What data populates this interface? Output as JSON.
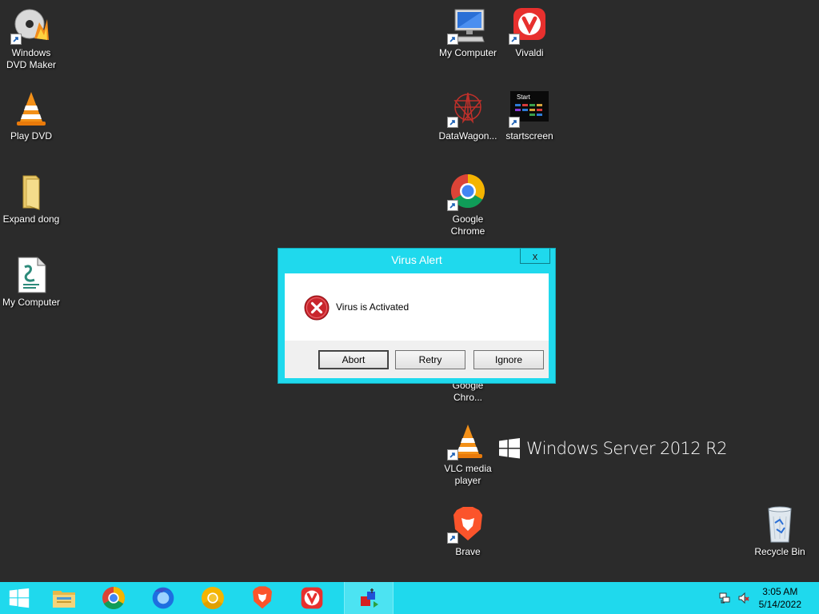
{
  "desktop": {
    "icons": [
      {
        "label": "Windows DVD Maker",
        "icon": "dvd-maker-icon"
      },
      {
        "label": "Play DVD",
        "icon": "vlc-cone-icon"
      },
      {
        "label": "Expand dong",
        "icon": "folder-icon"
      },
      {
        "label": "My Computer",
        "icon": "script-file-icon"
      },
      {
        "label": "My Computer",
        "icon": "computer-icon"
      },
      {
        "label": "Vivaldi",
        "icon": "vivaldi-icon"
      },
      {
        "label": "DataWagon...",
        "icon": "datawagon-icon"
      },
      {
        "label": "startscreen",
        "icon": "startscreen-icon"
      },
      {
        "label": "Google Chrome",
        "icon": "chrome-icon"
      },
      {
        "label": "Google Chro...",
        "icon": "chrome-icon"
      },
      {
        "label": "VLC media player",
        "icon": "vlc-cone-icon"
      },
      {
        "label": "Brave",
        "icon": "brave-icon"
      },
      {
        "label": "Recycle Bin",
        "icon": "recycle-bin-icon"
      }
    ],
    "branding": "Windows Server 2012 R2"
  },
  "dialog": {
    "title": "Virus Alert",
    "close_label": "x",
    "message": "Virus is Activated",
    "buttons": {
      "abort": "Abort",
      "retry": "Retry",
      "ignore": "Ignore"
    },
    "icon": "error-icon"
  },
  "taskbar": {
    "pinned": [
      "start-icon",
      "file-explorer-icon",
      "chrome-icon",
      "firefox-icon",
      "chrome-yellow-icon",
      "brave-icon",
      "vivaldi-icon",
      "app-icon"
    ],
    "clock": {
      "time": "3:05 AM",
      "date": "5/14/2022"
    }
  },
  "colors": {
    "taskbar": "#1fd9ed",
    "desktop": "#2b2b2b",
    "dialog_frame": "#1fd9ed"
  }
}
